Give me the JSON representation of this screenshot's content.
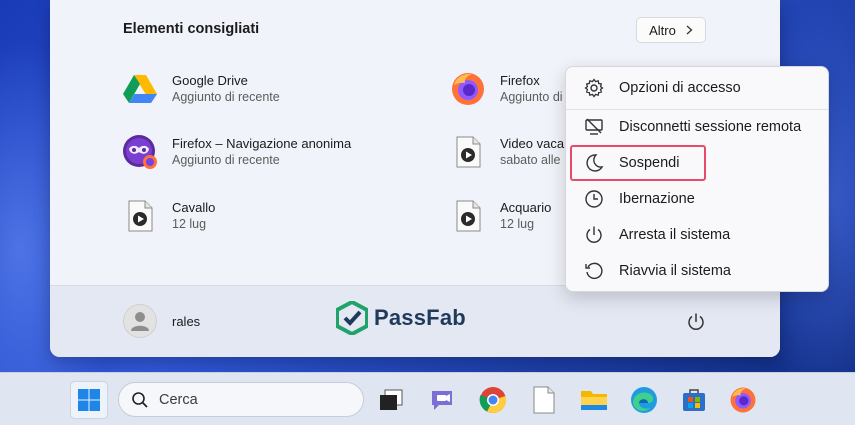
{
  "start_menu": {
    "section_title": "Elementi consigliati",
    "more_button": "Altro",
    "items": [
      {
        "name": "Google Drive",
        "sub": "Aggiunto di recente",
        "icon": "google-drive-icon"
      },
      {
        "name": "Firefox – Navigazione anonima",
        "sub": "Aggiunto di recente",
        "icon": "firefox-private-icon"
      },
      {
        "name": "Cavallo",
        "sub": "12 lug",
        "icon": "video-file-icon"
      },
      {
        "name": "Firefox",
        "sub": "Aggiunto di",
        "icon": "firefox-icon"
      },
      {
        "name": "Video vaca",
        "sub": "sabato alle",
        "icon": "video-file-icon"
      },
      {
        "name": "Acquario",
        "sub": "12 lug",
        "icon": "video-file-icon"
      }
    ],
    "user_name": "rales",
    "logo_text": "PassFab"
  },
  "power_menu": {
    "items": [
      {
        "label": "Opzioni di accesso",
        "icon": "gear-icon"
      },
      {
        "label": "Disconnetti sessione remota",
        "icon": "disconnect-icon"
      },
      {
        "label": "Sospendi",
        "icon": "moon-icon"
      },
      {
        "label": "Ibernazione",
        "icon": "clock-icon"
      },
      {
        "label": "Arresta il sistema",
        "icon": "power-icon"
      },
      {
        "label": "Riavvia il sistema",
        "icon": "restart-icon"
      }
    ],
    "highlight_color": "#e84a6a"
  },
  "taskbar": {
    "search_placeholder": "Cerca",
    "apps": [
      "windows-start-icon",
      "task-view-icon",
      "teams-chat-icon",
      "chrome-icon",
      "file-icon",
      "file-explorer-icon",
      "edge-icon",
      "store-icon",
      "firefox-icon"
    ]
  }
}
